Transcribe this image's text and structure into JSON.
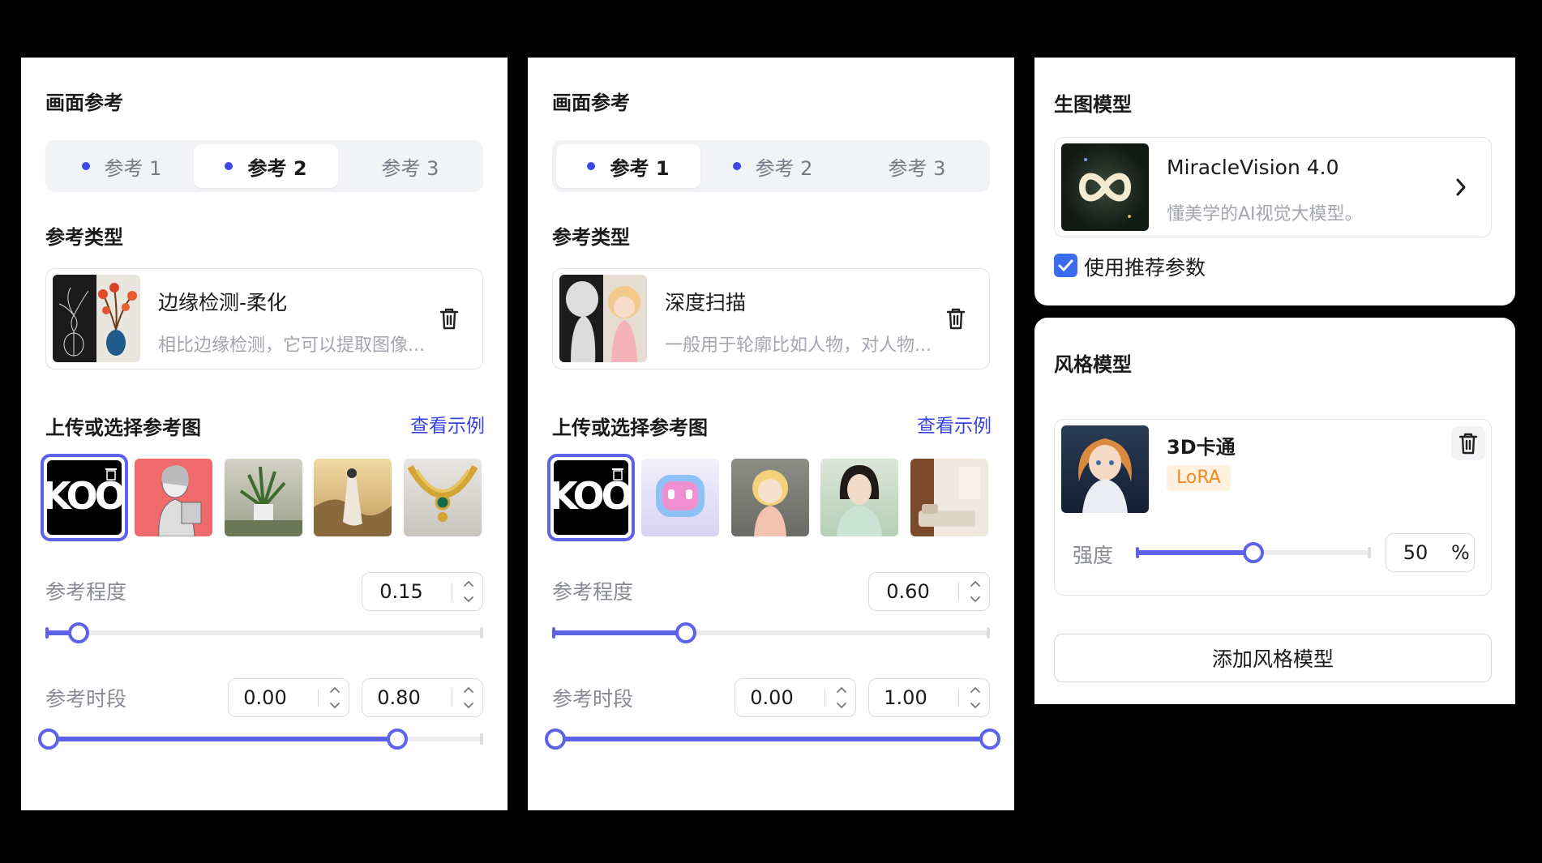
{
  "panels": [
    {
      "title": "画面参考",
      "tabs": [
        {
          "label": "参考 1",
          "dot": true,
          "active": false
        },
        {
          "label": "参考 2",
          "dot": true,
          "active": true
        },
        {
          "label": "参考 3",
          "dot": false,
          "active": false
        }
      ],
      "type_section_title": "参考类型",
      "type_card": {
        "name": "边缘检测-柔化",
        "desc": "相比边缘检测，它可以提取图像..."
      },
      "upload_title": "上传或选择参考图",
      "view_examples": "查看示例",
      "degree_label": "参考程度",
      "degree_value": "0.15",
      "degree": 0.15,
      "period_label": "参考时段",
      "period_start": "0.00",
      "period_end": "0.80",
      "period_range": [
        0.0,
        0.8
      ]
    },
    {
      "title": "画面参考",
      "tabs": [
        {
          "label": "参考 1",
          "dot": true,
          "active": true
        },
        {
          "label": "参考 2",
          "dot": true,
          "active": false
        },
        {
          "label": "参考 3",
          "dot": false,
          "active": false
        }
      ],
      "type_section_title": "参考类型",
      "type_card": {
        "name": "深度扫描",
        "desc": "一般用于轮廓比如人物，对人物..."
      },
      "upload_title": "上传或选择参考图",
      "view_examples": "查看示例",
      "degree_label": "参考程度",
      "degree_value": "0.60",
      "degree": 0.6,
      "period_label": "参考时段",
      "period_start": "0.00",
      "period_end": "1.00",
      "period_range": [
        0.0,
        1.0
      ]
    }
  ],
  "gen_model": {
    "title": "生图模型",
    "name": "MiracleVision 4.0",
    "desc": "懂美学的AI视觉大模型。",
    "use_recommended": "使用推荐参数",
    "use_recommended_checked": true
  },
  "style_model": {
    "title": "风格模型",
    "name": "3D卡通",
    "badge": "LoRA",
    "strength_label": "强度",
    "strength_value": "50",
    "strength_unit": "%",
    "strength": 0.5,
    "add_button": "添加风格模型"
  },
  "colors": {
    "accent": "#5c63ea",
    "link": "#3a45e0",
    "checkbox": "#3a6cf0",
    "badge_text": "#f08a24"
  }
}
